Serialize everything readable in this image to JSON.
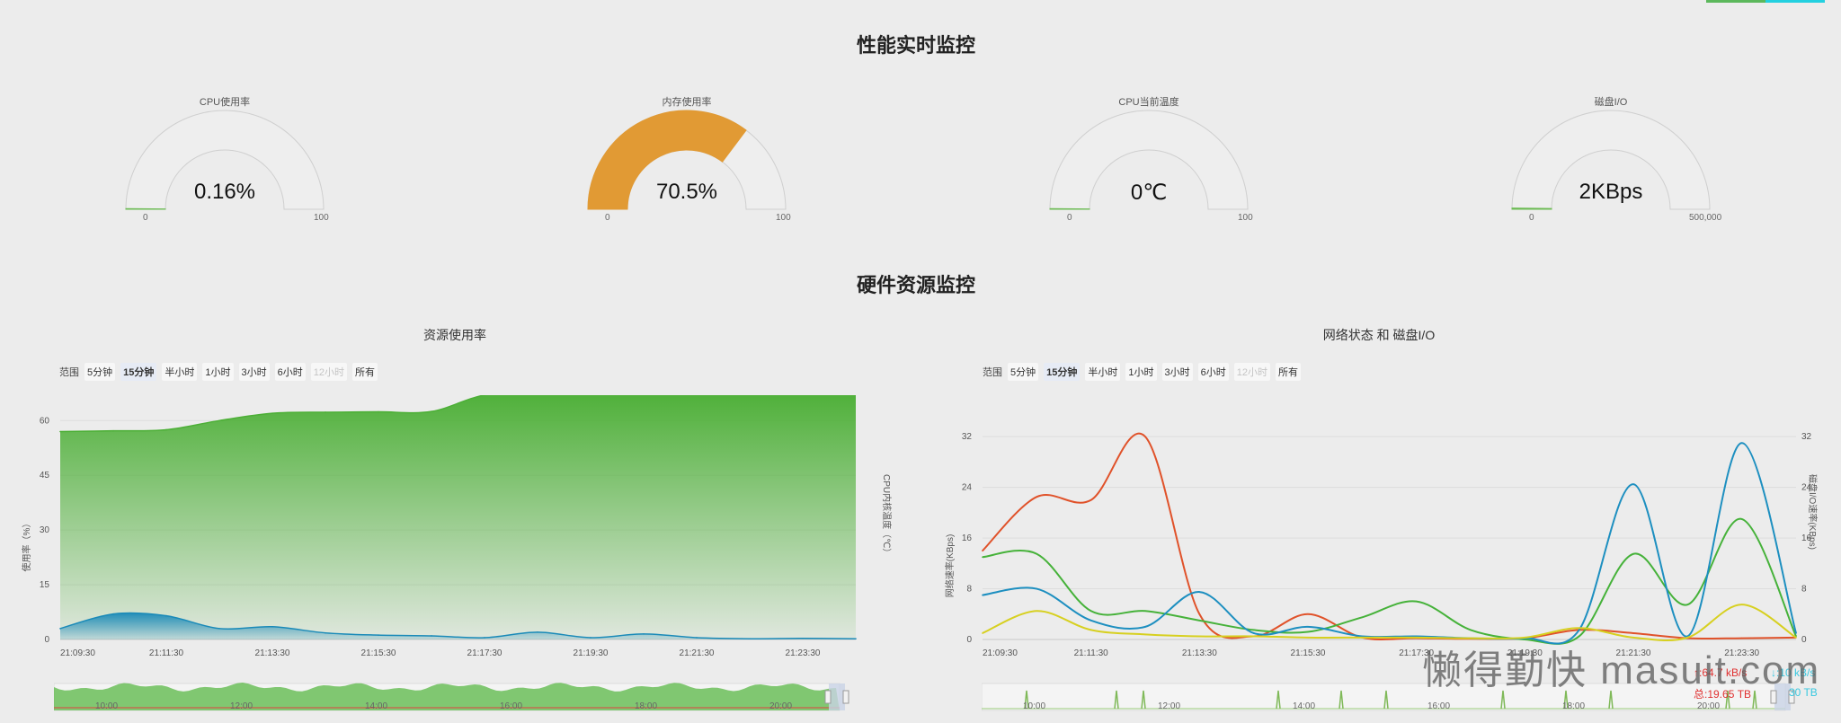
{
  "titles": {
    "realtime": "性能实时监控",
    "hardware": "硬件资源监控"
  },
  "gauges": [
    {
      "label": "CPU使用率",
      "value": "0.16%",
      "min": "0",
      "max": "100",
      "fraction": 0.0016,
      "color": "#6dbb55"
    },
    {
      "label": "内存使用率",
      "value": "70.5%",
      "min": "0",
      "max": "100",
      "fraction": 0.705,
      "color": "#e19a34"
    },
    {
      "label": "CPU当前温度",
      "value": "0℃",
      "min": "0",
      "max": "100",
      "fraction": 0,
      "color": "#6dbb55"
    },
    {
      "label": "磁盘I/O",
      "value": "2KBps",
      "min": "0",
      "max": "500,000",
      "fraction": 0.004,
      "color": "#6dbb55"
    }
  ],
  "panels": {
    "left": {
      "title": "资源使用率",
      "range_label": "范围",
      "ranges": [
        {
          "label": "5分钟",
          "state": "normal"
        },
        {
          "label": "15分钟",
          "state": "selected"
        },
        {
          "label": "半小时",
          "state": "normal"
        },
        {
          "label": "1小时",
          "state": "normal"
        },
        {
          "label": "3小时",
          "state": "normal"
        },
        {
          "label": "6小时",
          "state": "normal"
        },
        {
          "label": "12小时",
          "state": "disabled"
        },
        {
          "label": "所有",
          "state": "normal"
        }
      ],
      "y_title": "使用率（%）",
      "y2_title": "CPU内核温度（℃）",
      "nav_labels": [
        "10:00",
        "12:00",
        "14:00",
        "16:00",
        "18:00",
        "20:00"
      ]
    },
    "right": {
      "title": "网络状态 和 磁盘I/O",
      "range_label": "范围",
      "ranges": [
        {
          "label": "5分钟",
          "state": "normal"
        },
        {
          "label": "15分钟",
          "state": "selected"
        },
        {
          "label": "半小时",
          "state": "normal"
        },
        {
          "label": "1小时",
          "state": "normal"
        },
        {
          "label": "3小时",
          "state": "normal"
        },
        {
          "label": "6小时",
          "state": "normal"
        },
        {
          "label": "12小时",
          "state": "disabled"
        },
        {
          "label": "所有",
          "state": "normal"
        }
      ],
      "y_title": "网络速率(KBps)",
      "y2_title": "磁盘I/O速率(KBps)",
      "nav_labels": [
        "10:00",
        "12:00",
        "14:00",
        "16:00",
        "18:00",
        "20:00"
      ],
      "legend": [
        {
          "text": "↑:64.7 kB/s",
          "color": "#e03030"
        },
        {
          "text": "总:19.65 TB",
          "color": "#e03030"
        },
        {
          "text": "↓:10 kB/s",
          "color": "#38c8e0"
        },
        {
          "text": "30 TB",
          "color": "#38c8e0"
        }
      ]
    }
  },
  "watermark": "懒得勤快  masuit.com",
  "chart_data": [
    {
      "type": "area",
      "x_type": "time",
      "x": [
        "21:09:30",
        "21:10:30",
        "21:11:30",
        "21:12:30",
        "21:13:30",
        "21:14:30",
        "21:15:30",
        "21:16:30",
        "21:17:30",
        "21:18:30",
        "21:19:30",
        "21:20:30",
        "21:21:30",
        "21:22:30",
        "21:23:30",
        "21:24:30"
      ],
      "x_ticks": [
        "21:09:30",
        "21:11:30",
        "21:13:30",
        "21:15:30",
        "21:17:30",
        "21:19:30",
        "21:21:30",
        "21:23:30"
      ],
      "ylabel": "使用率（%）",
      "y2label": "CPU内核温度（℃）",
      "ylim": [
        0,
        65
      ],
      "y_ticks": [
        0,
        15,
        30,
        45,
        60
      ],
      "series": [
        {
          "values": [
            57,
            57.2,
            57.5,
            60,
            62,
            62.3,
            62.4,
            62.5,
            67,
            67.3,
            67.6,
            67.9,
            68.2,
            68.5,
            68.8,
            69
          ],
          "color": "#4caf36"
        },
        {
          "values": [
            3,
            7,
            6.5,
            3,
            3.5,
            1.8,
            1.2,
            1,
            0.5,
            2,
            0.5,
            1.5,
            0.5,
            0.2,
            0.3,
            0.2
          ],
          "color": "#1a8ab8"
        }
      ]
    },
    {
      "type": "line",
      "x_type": "time",
      "x": [
        "21:09:30",
        "21:10:30",
        "21:11:30",
        "21:12:30",
        "21:13:30",
        "21:14:30",
        "21:15:30",
        "21:16:30",
        "21:17:30",
        "21:18:30",
        "21:19:30",
        "21:20:30",
        "21:21:30",
        "21:22:30",
        "21:23:30",
        "21:24:30"
      ],
      "x_ticks": [
        "21:09:30",
        "21:11:30",
        "21:13:30",
        "21:15:30",
        "21:17:30",
        "21:19:30",
        "21:21:30",
        "21:23:30"
      ],
      "ylabel": "网络速率(KBps)",
      "y2label": "磁盘I/O速率(KBps)",
      "ylim": [
        0,
        35
      ],
      "y_ticks": [
        0,
        8,
        16,
        24,
        32
      ],
      "series": [
        {
          "values": [
            14,
            22.5,
            22,
            32,
            4,
            0.5,
            4,
            0.3,
            0.2,
            0.1,
            0.2,
            1.5,
            1,
            0.2,
            0.2,
            0.3
          ],
          "color": "#e0522a"
        },
        {
          "values": [
            13,
            13.5,
            4.5,
            4.5,
            3,
            1.5,
            1.2,
            3.5,
            6,
            1.5,
            0,
            0.5,
            13.5,
            5.5,
            19,
            0.5
          ],
          "color": "#46b23a"
        },
        {
          "values": [
            7,
            8,
            3,
            2,
            7.5,
            1,
            2,
            0.5,
            0.5,
            0.2,
            0.2,
            1.5,
            24.5,
            0.5,
            31,
            1
          ],
          "color": "#1d8fc0"
        },
        {
          "values": [
            1,
            4.5,
            1.5,
            0.8,
            0.5,
            0.5,
            0.3,
            0.3,
            0.3,
            0.2,
            0.3,
            1.8,
            0.3,
            0.3,
            5.5,
            0.3
          ],
          "color": "#d7d020"
        }
      ]
    }
  ]
}
